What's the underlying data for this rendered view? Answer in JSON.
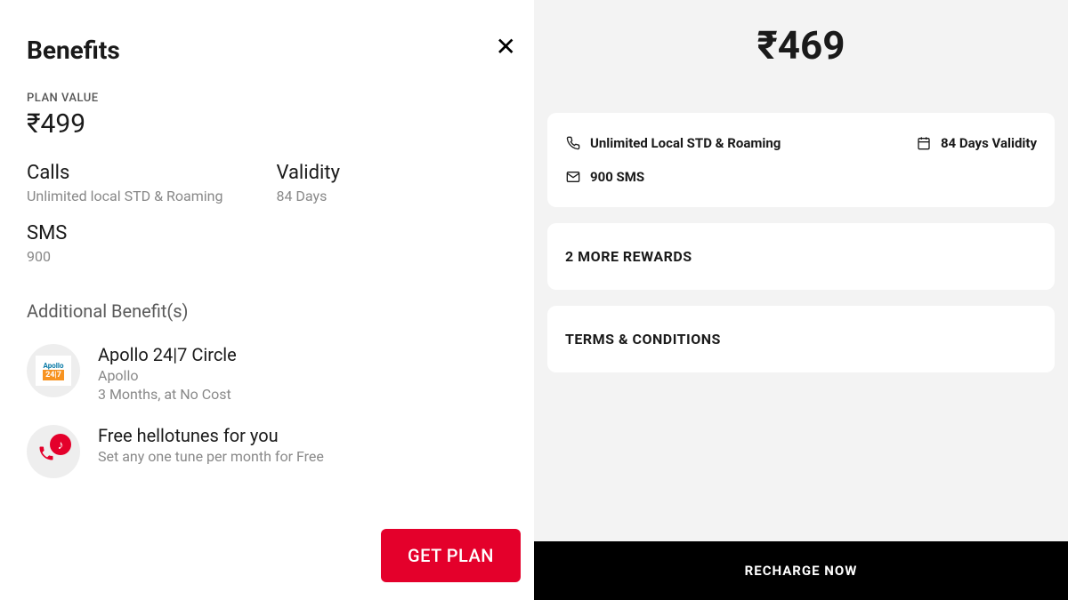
{
  "left": {
    "title": "Benefits",
    "plan_value_label": "PLAN VALUE",
    "plan_value_price": "₹499",
    "calls_label": "Calls",
    "calls_value": "Unlimited local STD & Roaming",
    "validity_label": "Validity",
    "validity_value": "84 Days",
    "sms_label": "SMS",
    "sms_value": "900",
    "additional_title": "Additional Benefit(s)",
    "benefits": [
      {
        "title": "Apollo 24|7 Circle",
        "subtitle": "Apollo",
        "detail": "3 Months, at No Cost"
      },
      {
        "title": "Free hellotunes for you",
        "subtitle": "Set any one tune per month for Free",
        "detail": ""
      }
    ],
    "get_plan_label": "GET PLAN"
  },
  "right": {
    "price": "₹469",
    "features": {
      "calls": "Unlimited Local STD & Roaming",
      "validity": "84 Days Validity",
      "sms": "900 SMS"
    },
    "rewards_title": "2 MORE REWARDS",
    "terms_title": "TERMS & CONDITIONS",
    "recharge_label": "RECHARGE NOW"
  }
}
